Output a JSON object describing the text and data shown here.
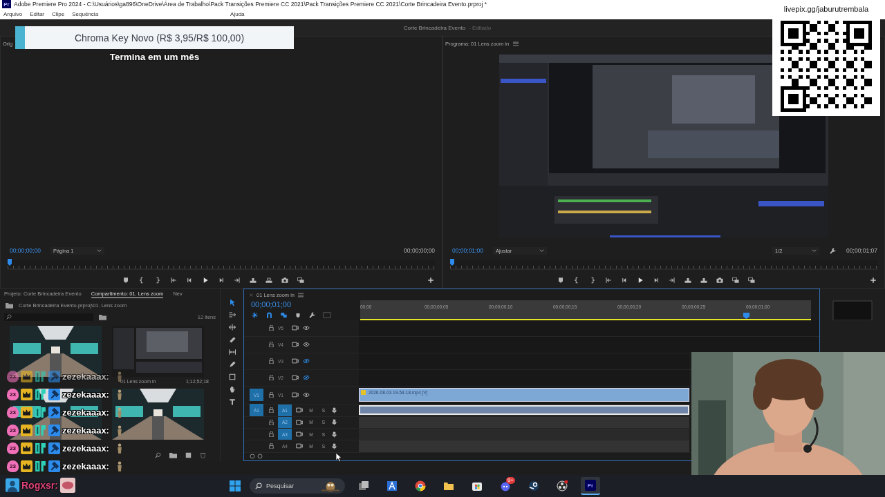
{
  "title_bar": {
    "app_icon": "Pr",
    "title": "Adobe Premiere Pro 2024 - C:\\Usuários\\ga896\\OneDrive\\Área de Trabalho\\Pack Transições Premiere CC 2021\\Pack Transições Premiere CC 2021\\Corte Brincadeira Evento.prproj *"
  },
  "menu": [
    "Arquivo",
    "Editar",
    "Clipe",
    "Sequência",
    "Ajuda"
  ],
  "workspace": {
    "project": "Corte Brincadeira Evento",
    "status": "- Editado"
  },
  "source_monitor": {
    "label": "Orig",
    "timecode": "00;00;00;00",
    "page": "Página 1",
    "duration": "00;00;00;00"
  },
  "program_monitor": {
    "title": "Programa: 01 Lens zoom in",
    "timecode": "00;00;01;00",
    "zoom": "Ajustar",
    "resolution": "1/2",
    "duration": "00;00;01;07"
  },
  "project_panel": {
    "tabs": [
      {
        "label": "Projeto: Corte Brincadeira Evento",
        "selected": false
      },
      {
        "label": "Compartimento: 01. Lens zoom",
        "selected": true
      },
      {
        "label": "Nev",
        "selected": false
      }
    ],
    "path": "Corte Brincadeira Evento.prproj\\01. Lens zoom",
    "item_count": "12 itens",
    "items": [
      {
        "kind": "corridor"
      },
      {
        "kind": "screen",
        "name": "01 Lens zoom in",
        "duration": "1;12;52;18"
      },
      {
        "kind": "corridor"
      },
      {
        "kind": "corridor"
      }
    ]
  },
  "timeline": {
    "tab": "01 Lens zoom in",
    "timecode": "00;00;01;00",
    "ruler": [
      "00;00",
      "00;00;00;05",
      "00;00;00;10",
      "00;00;00;15",
      "00;00;00;20",
      "00;00;00;25",
      "00;00;01;00"
    ],
    "video_tracks": [
      {
        "label": "V5",
        "visible": true
      },
      {
        "label": "V4",
        "visible": true
      },
      {
        "label": "V3",
        "visible": false
      },
      {
        "label": "V2",
        "visible": false
      },
      {
        "label": "V1",
        "visible": true,
        "source": "V1",
        "clip": "2026-08-03 19-54-18.mp4 [V]"
      }
    ],
    "audio_tracks": [
      {
        "label": "A1",
        "targeted": true,
        "source": "A1",
        "mute": "M",
        "solo": "S",
        "clip": true
      },
      {
        "label": "A2",
        "targeted": true,
        "mute": "M",
        "solo": "S",
        "clip": false
      },
      {
        "label": "A3",
        "targeted": true,
        "mute": "M",
        "solo": "S",
        "clip": false
      },
      {
        "label": "A4",
        "targeted": false,
        "mute": "M",
        "solo": "S",
        "clip": false
      }
    ]
  },
  "donation_alert": {
    "title": "Chroma Key Novo (R$ 3,95/R$ 100,00)",
    "subtitle": "Termina em um mês"
  },
  "qr_panel": {
    "url": "livepix.gg/jaburutrembala"
  },
  "chat": [
    {
      "badge": "23",
      "user": "zezekaaax:",
      "faded": true
    },
    {
      "badge": "23",
      "user": "zezekaaax:",
      "faded": false
    },
    {
      "badge": "23",
      "user": "zezekaaax:",
      "faded": false
    },
    {
      "badge": "23",
      "user": "zezekaaax:",
      "faded": false
    },
    {
      "badge": "23",
      "user": "zezekaaax:",
      "faded": false
    },
    {
      "badge": "23",
      "user": "zezekaaax:",
      "faded": false
    }
  ],
  "chat_footer": {
    "user": "Rogxsr:"
  },
  "taskbar": {
    "search": "Pesquisar",
    "apps": [
      {
        "kind": "taskview",
        "selected": false
      },
      {
        "kind": "editor",
        "selected": false
      },
      {
        "kind": "chrome",
        "selected": false
      },
      {
        "kind": "folder",
        "selected": false
      },
      {
        "kind": "store",
        "selected": false
      },
      {
        "kind": "discord",
        "badge": "9+",
        "selected": false
      },
      {
        "kind": "steam",
        "selected": false
      },
      {
        "kind": "obs",
        "selected": false
      },
      {
        "kind": "premiere",
        "label": "Pr",
        "selected": true
      }
    ]
  }
}
